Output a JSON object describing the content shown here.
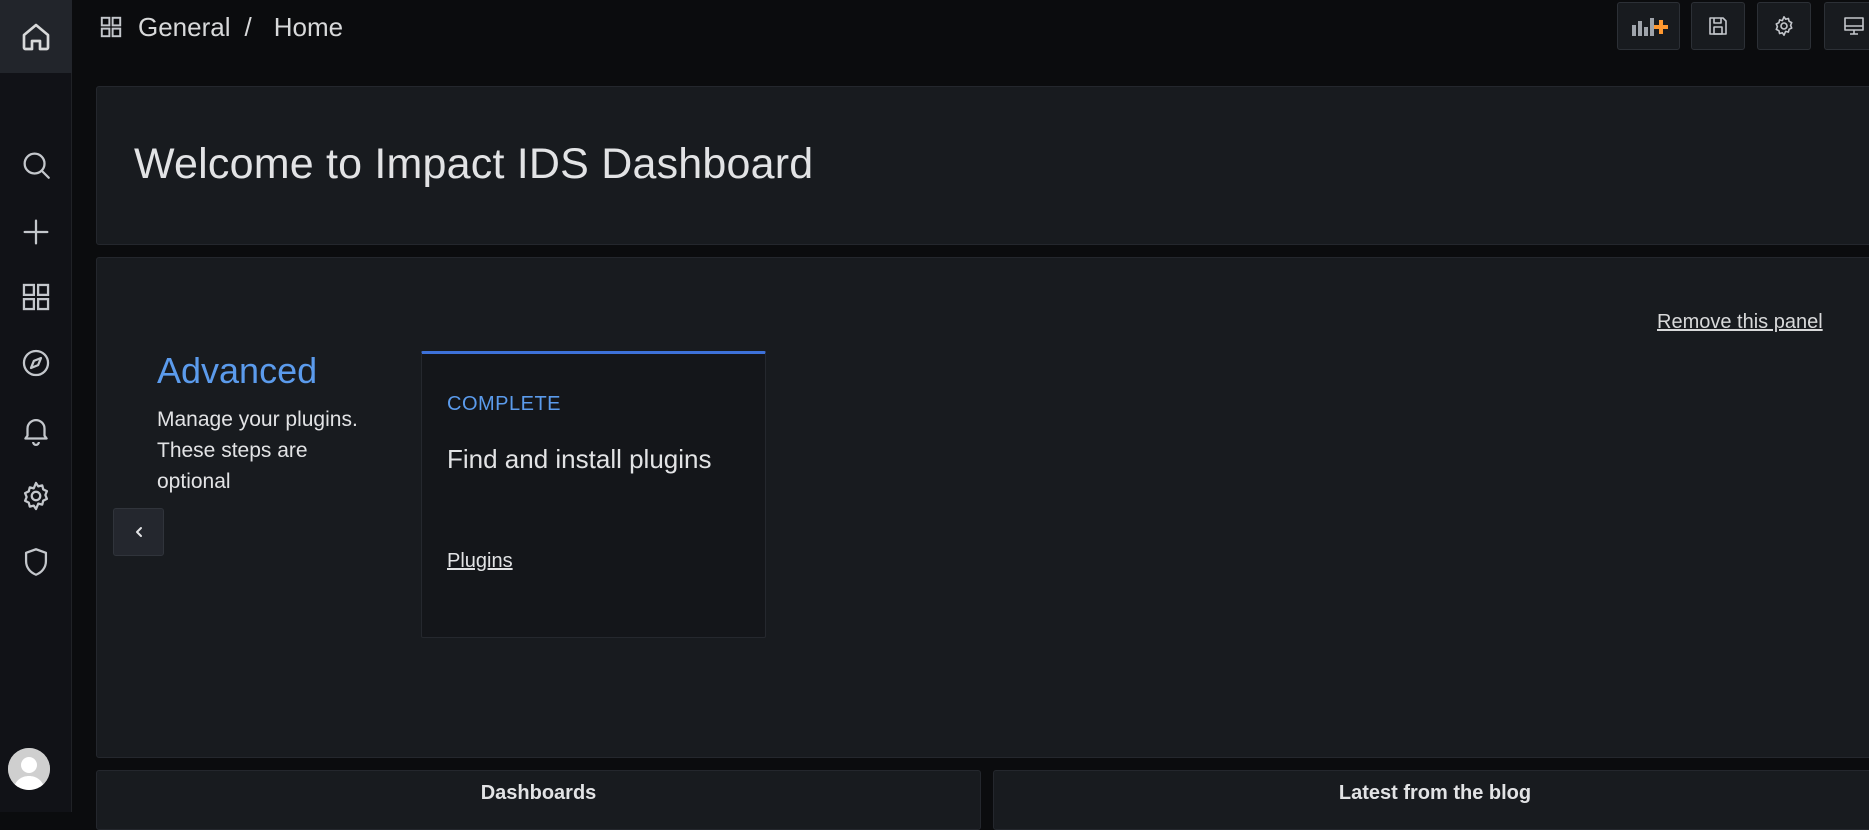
{
  "breadcrumb": {
    "folder": "General",
    "separator": "/",
    "page": "Home"
  },
  "icons": {
    "home": "home-icon",
    "search": "search-icon",
    "create": "plus-icon",
    "dashboards": "apps-grid-icon",
    "explore": "compass-icon",
    "alerting": "bell-icon",
    "configuration": "gear-icon",
    "server_admin": "shield-icon",
    "add_panel": "add-panel-icon",
    "save": "save-icon",
    "settings": "gear-icon",
    "view_mode": "monitor-icon"
  },
  "welcome": {
    "title": "Welcome to Impact IDS Dashboard"
  },
  "getting_started": {
    "remove_link": "Remove this panel",
    "section_title": "Advanced",
    "section_description": "Manage your plugins. These steps are optional",
    "card": {
      "status": "COMPLETE",
      "title": "Find and install plugins",
      "link": "Plugins"
    }
  },
  "bottom_panels": {
    "dashboards_title": "Dashboards",
    "blog_title": "Latest from the blog"
  },
  "colors": {
    "accent_blue": "#5b9bec",
    "card_top_border": "#3d71d9",
    "add_panel_orange": "#ff9830",
    "background": "#0b0c0e",
    "panel": "#181b1f"
  }
}
